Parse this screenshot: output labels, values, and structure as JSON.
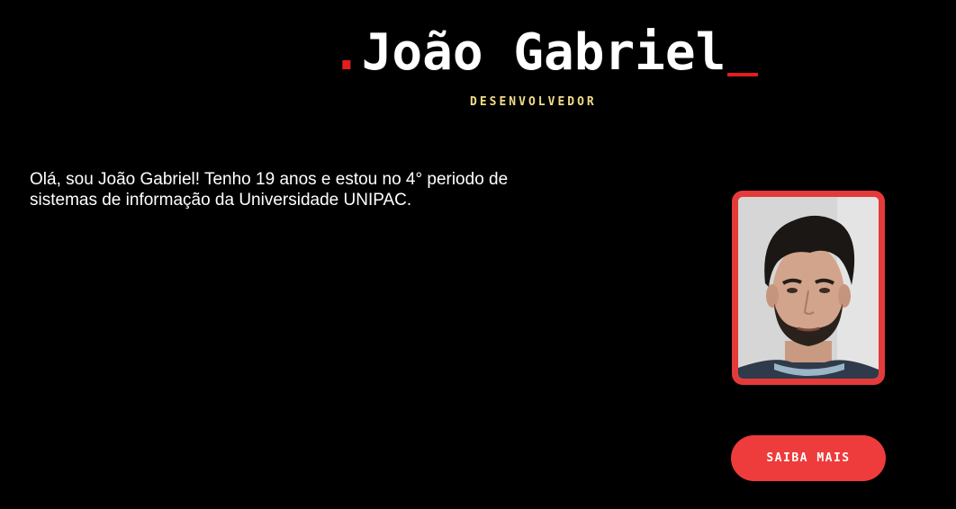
{
  "header": {
    "dot": ".",
    "name": "João Gabriel",
    "role": "DESENVOLVEDOR"
  },
  "bio": {
    "text": "Olá, sou João Gabriel! Tenho 19 anos e estou no 4° periodo de sistemas de informação da Universidade UNIPAC."
  },
  "profile": {
    "photo_alt": "João Gabriel"
  },
  "cta": {
    "label": "SAIBA MAIS"
  },
  "colors": {
    "background": "#000000",
    "accent": "#e53a3a",
    "subtitle": "#f2dc8a",
    "text": "#ffffff"
  }
}
